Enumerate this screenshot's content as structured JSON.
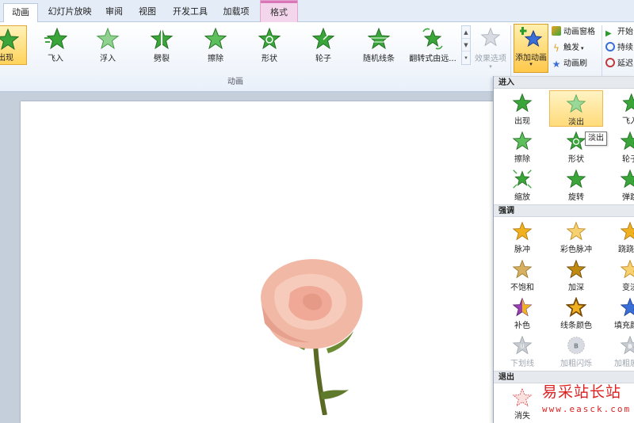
{
  "tabs": [
    {
      "label": "动画",
      "active": true
    },
    {
      "label": "幻灯片放映",
      "active": false
    },
    {
      "label": "审阅",
      "active": false
    },
    {
      "label": "视图",
      "active": false
    },
    {
      "label": "开发工具",
      "active": false
    },
    {
      "label": "加载项",
      "active": false
    },
    {
      "label": "格式",
      "active": false
    }
  ],
  "ribbon": {
    "gallery": [
      {
        "label": "出现",
        "icon": "star-appear-icon",
        "selected": true
      },
      {
        "label": "飞入",
        "icon": "star-fly-in-icon"
      },
      {
        "label": "浮入",
        "icon": "star-float-in-icon"
      },
      {
        "label": "劈裂",
        "icon": "star-split-icon"
      },
      {
        "label": "擦除",
        "icon": "star-wipe-icon"
      },
      {
        "label": "形状",
        "icon": "star-shape-icon"
      },
      {
        "label": "轮子",
        "icon": "star-wheel-icon"
      },
      {
        "label": "随机线条",
        "icon": "star-random-bars-icon"
      },
      {
        "label": "翻转式由远...",
        "icon": "star-grow-turn-icon"
      }
    ],
    "effect_options_label": "效果选项",
    "group_label": "动画",
    "add_animation_label": "添加动画",
    "animation_pane_label": "动画窗格",
    "trigger_label": "触发",
    "animation_painter_label": "动画刷",
    "start_label": "开始",
    "duration_label": "持续",
    "delay_label": "延迟"
  },
  "dropdown": {
    "sections": [
      {
        "title": "进入",
        "items": [
          {
            "label": "出现",
            "color": "green"
          },
          {
            "label": "淡出",
            "color": "green",
            "highlighted": true
          },
          {
            "label": "飞入",
            "color": "green"
          },
          {
            "label": "擦除",
            "color": "green"
          },
          {
            "label": "形状",
            "color": "green"
          },
          {
            "label": "轮子",
            "color": "green"
          },
          {
            "label": "缩放",
            "color": "green"
          },
          {
            "label": "旋转",
            "color": "green"
          },
          {
            "label": "弹跳",
            "color": "green"
          }
        ]
      },
      {
        "title": "强调",
        "items": [
          {
            "label": "脉冲",
            "color": "gold"
          },
          {
            "label": "彩色脉冲",
            "color": "gold"
          },
          {
            "label": "跷跷板",
            "color": "gold"
          },
          {
            "label": "不饱和",
            "color": "gold"
          },
          {
            "label": "加深",
            "color": "gold"
          },
          {
            "label": "变淡",
            "color": "gold"
          },
          {
            "label": "补色",
            "color": "purple"
          },
          {
            "label": "线条颜色",
            "color": "gold"
          },
          {
            "label": "填充颜色",
            "color": "gold"
          },
          {
            "label": "下划线",
            "color": "grey",
            "disabled": true
          },
          {
            "label": "加粗闪烁",
            "color": "grey",
            "disabled": true
          },
          {
            "label": "加粗展示",
            "color": "grey",
            "disabled": true
          }
        ]
      },
      {
        "title": "退出",
        "items": [
          {
            "label": "消失",
            "color": "red"
          }
        ]
      }
    ],
    "tooltip": "淡出"
  },
  "watermark": {
    "title": "易采站长站",
    "url": "www.easck.com"
  },
  "colors": {
    "green": "#3aa63a",
    "gold": "#f0b020",
    "purple": "#9a3fb5",
    "grey": "#b8bcc2",
    "red": "#d84040",
    "accent": "#ffd35c"
  }
}
